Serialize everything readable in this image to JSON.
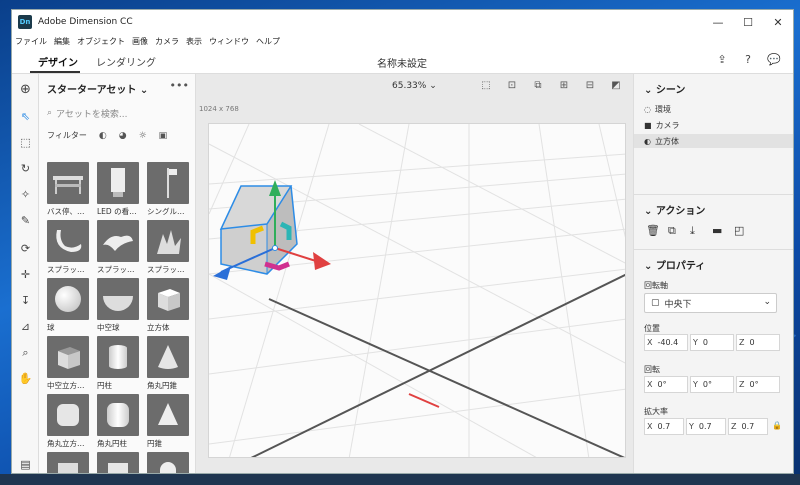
{
  "window": {
    "title": "Adobe Dimension CC",
    "logo_text": "Dn",
    "controls": [
      "—",
      "☐",
      "✕"
    ]
  },
  "menu": [
    "ファイル",
    "編集",
    "オブジェクト",
    "画像",
    "カメラ",
    "表示",
    "ウィンドウ",
    "ヘルプ"
  ],
  "tabs": {
    "design": "デザイン",
    "render": "レンダリング"
  },
  "document_title": "名称未設定",
  "top_icons": [
    "⇪",
    "?",
    "💬"
  ],
  "toolbar_icons": [
    "add-icon",
    "select-icon",
    "marquee-icon",
    "rotate-icon",
    "magic-wand-icon",
    "eyedropper-icon",
    "orbit-icon",
    "pan-icon",
    "dolly-icon",
    "horizon-icon",
    "zoom-icon",
    "hand-icon",
    "panel-icon"
  ],
  "assets": {
    "title": "スターターアセット",
    "more": "•••",
    "search_placeholder": "アセットを検索...",
    "filter_label": "フィルター",
    "items": [
      {
        "label": "バス停、…"
      },
      {
        "label": "LED の看…"
      },
      {
        "label": "シングル…"
      },
      {
        "label": "スプラッ…"
      },
      {
        "label": "スプラッ…"
      },
      {
        "label": "スプラッ…"
      },
      {
        "label": "球"
      },
      {
        "label": "中空球"
      },
      {
        "label": "立方体"
      },
      {
        "label": "中空立方…"
      },
      {
        "label": "円柱"
      },
      {
        "label": "角丸円錐"
      },
      {
        "label": "角丸立方…"
      },
      {
        "label": "角丸円柱"
      },
      {
        "label": "円錐"
      },
      {
        "label": ""
      },
      {
        "label": ""
      },
      {
        "label": ""
      }
    ]
  },
  "canvas": {
    "zoom": "65.33%",
    "size": "1024 x 768"
  },
  "scene": {
    "title": "シーン",
    "items": [
      {
        "label": "環境",
        "icon": "environment-icon"
      },
      {
        "label": "カメラ",
        "icon": "camera-icon"
      },
      {
        "label": "立方体",
        "icon": "cube-icon",
        "selected": true
      }
    ]
  },
  "actions": {
    "title": "アクション"
  },
  "properties": {
    "title": "プロパティ",
    "pivot_label": "回転軸",
    "pivot_value": "中央下",
    "position_label": "位置",
    "position": {
      "x": "-40.4",
      "y": "0",
      "z": "0"
    },
    "rotation_label": "回転",
    "rotation": {
      "x": "0°",
      "y": "0°",
      "z": "0°"
    },
    "scale_label": "拡大率",
    "scale": {
      "x": "0.7",
      "y": "0.7",
      "z": "0.7"
    }
  },
  "colors": {
    "accent": "#2d8ce6",
    "x_axis": "#e04040",
    "y_axis": "#2fae5a",
    "z_axis": "#2a6fd8"
  }
}
